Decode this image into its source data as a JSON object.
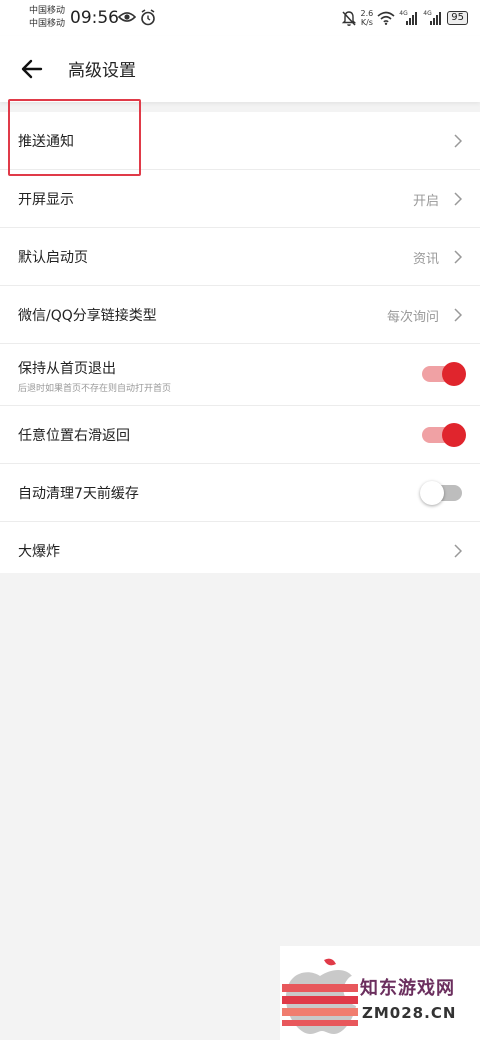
{
  "status_bar": {
    "carrier_1": "中国移动",
    "carrier_2": "中国移动",
    "time": "09:56",
    "speed_value": "2.6",
    "speed_unit": "K/s",
    "signal_1_type": "4G",
    "signal_2_type": "4G",
    "battery": "95"
  },
  "header": {
    "title": "高级设置"
  },
  "settings": [
    {
      "label": "推送通知"
    },
    {
      "label": "开屏显示",
      "value": "开启"
    },
    {
      "label": "默认启动页",
      "value": "资讯"
    },
    {
      "label": "微信/QQ分享链接类型",
      "value": "每次询问"
    },
    {
      "label": "保持从首页退出",
      "sub": "后退时如果首页不存在则自动打开首页",
      "toggle": true
    },
    {
      "label": "任意位置右滑返回",
      "toggle": true
    },
    {
      "label": "自动清理7天前缓存",
      "toggle": false
    },
    {
      "label": "大爆炸"
    }
  ],
  "watermark": {
    "title": "知东游戏网",
    "url": "ZM028.CN"
  },
  "colors": {
    "accent": "#e0252d",
    "highlight": "#e03a48"
  }
}
